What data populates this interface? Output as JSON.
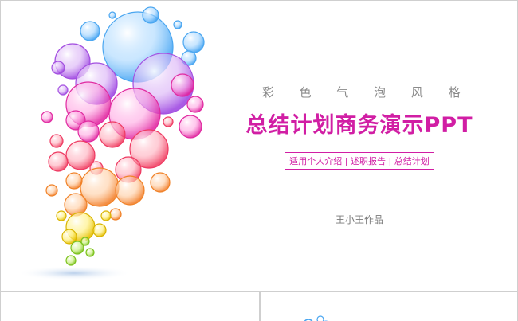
{
  "slide": {
    "subtitle": "彩 色 气 泡 风 格",
    "title": "总结计划商务演示PPT",
    "tags": "适用个人介绍 | 述职报告 | 总结计划",
    "author": "王小王作品"
  },
  "colors": {
    "accent": "#d11ea4",
    "subtitle": "#8a8a8a",
    "author": "#7a7a7a",
    "border": "#cfcfcf"
  },
  "thumbnails": [
    {
      "name": "slide-thumbnail-1"
    },
    {
      "name": "slide-thumbnail-2"
    }
  ]
}
